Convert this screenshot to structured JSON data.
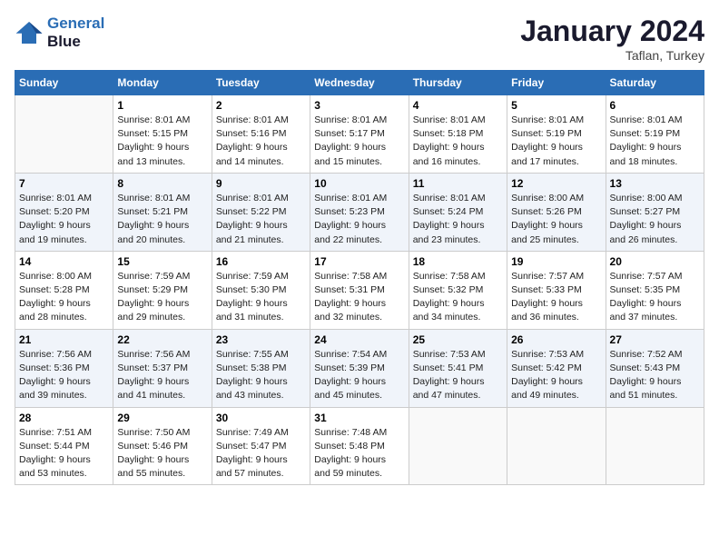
{
  "header": {
    "logo_line1": "General",
    "logo_line2": "Blue",
    "month": "January 2024",
    "location": "Taflan, Turkey"
  },
  "days_of_week": [
    "Sunday",
    "Monday",
    "Tuesday",
    "Wednesday",
    "Thursday",
    "Friday",
    "Saturday"
  ],
  "weeks": [
    [
      {
        "day": "",
        "info": ""
      },
      {
        "day": "1",
        "info": "Sunrise: 8:01 AM\nSunset: 5:15 PM\nDaylight: 9 hours\nand 13 minutes."
      },
      {
        "day": "2",
        "info": "Sunrise: 8:01 AM\nSunset: 5:16 PM\nDaylight: 9 hours\nand 14 minutes."
      },
      {
        "day": "3",
        "info": "Sunrise: 8:01 AM\nSunset: 5:17 PM\nDaylight: 9 hours\nand 15 minutes."
      },
      {
        "day": "4",
        "info": "Sunrise: 8:01 AM\nSunset: 5:18 PM\nDaylight: 9 hours\nand 16 minutes."
      },
      {
        "day": "5",
        "info": "Sunrise: 8:01 AM\nSunset: 5:19 PM\nDaylight: 9 hours\nand 17 minutes."
      },
      {
        "day": "6",
        "info": "Sunrise: 8:01 AM\nSunset: 5:19 PM\nDaylight: 9 hours\nand 18 minutes."
      }
    ],
    [
      {
        "day": "7",
        "info": "Sunrise: 8:01 AM\nSunset: 5:20 PM\nDaylight: 9 hours\nand 19 minutes."
      },
      {
        "day": "8",
        "info": "Sunrise: 8:01 AM\nSunset: 5:21 PM\nDaylight: 9 hours\nand 20 minutes."
      },
      {
        "day": "9",
        "info": "Sunrise: 8:01 AM\nSunset: 5:22 PM\nDaylight: 9 hours\nand 21 minutes."
      },
      {
        "day": "10",
        "info": "Sunrise: 8:01 AM\nSunset: 5:23 PM\nDaylight: 9 hours\nand 22 minutes."
      },
      {
        "day": "11",
        "info": "Sunrise: 8:01 AM\nSunset: 5:24 PM\nDaylight: 9 hours\nand 23 minutes."
      },
      {
        "day": "12",
        "info": "Sunrise: 8:00 AM\nSunset: 5:26 PM\nDaylight: 9 hours\nand 25 minutes."
      },
      {
        "day": "13",
        "info": "Sunrise: 8:00 AM\nSunset: 5:27 PM\nDaylight: 9 hours\nand 26 minutes."
      }
    ],
    [
      {
        "day": "14",
        "info": "Sunrise: 8:00 AM\nSunset: 5:28 PM\nDaylight: 9 hours\nand 28 minutes."
      },
      {
        "day": "15",
        "info": "Sunrise: 7:59 AM\nSunset: 5:29 PM\nDaylight: 9 hours\nand 29 minutes."
      },
      {
        "day": "16",
        "info": "Sunrise: 7:59 AM\nSunset: 5:30 PM\nDaylight: 9 hours\nand 31 minutes."
      },
      {
        "day": "17",
        "info": "Sunrise: 7:58 AM\nSunset: 5:31 PM\nDaylight: 9 hours\nand 32 minutes."
      },
      {
        "day": "18",
        "info": "Sunrise: 7:58 AM\nSunset: 5:32 PM\nDaylight: 9 hours\nand 34 minutes."
      },
      {
        "day": "19",
        "info": "Sunrise: 7:57 AM\nSunset: 5:33 PM\nDaylight: 9 hours\nand 36 minutes."
      },
      {
        "day": "20",
        "info": "Sunrise: 7:57 AM\nSunset: 5:35 PM\nDaylight: 9 hours\nand 37 minutes."
      }
    ],
    [
      {
        "day": "21",
        "info": "Sunrise: 7:56 AM\nSunset: 5:36 PM\nDaylight: 9 hours\nand 39 minutes."
      },
      {
        "day": "22",
        "info": "Sunrise: 7:56 AM\nSunset: 5:37 PM\nDaylight: 9 hours\nand 41 minutes."
      },
      {
        "day": "23",
        "info": "Sunrise: 7:55 AM\nSunset: 5:38 PM\nDaylight: 9 hours\nand 43 minutes."
      },
      {
        "day": "24",
        "info": "Sunrise: 7:54 AM\nSunset: 5:39 PM\nDaylight: 9 hours\nand 45 minutes."
      },
      {
        "day": "25",
        "info": "Sunrise: 7:53 AM\nSunset: 5:41 PM\nDaylight: 9 hours\nand 47 minutes."
      },
      {
        "day": "26",
        "info": "Sunrise: 7:53 AM\nSunset: 5:42 PM\nDaylight: 9 hours\nand 49 minutes."
      },
      {
        "day": "27",
        "info": "Sunrise: 7:52 AM\nSunset: 5:43 PM\nDaylight: 9 hours\nand 51 minutes."
      }
    ],
    [
      {
        "day": "28",
        "info": "Sunrise: 7:51 AM\nSunset: 5:44 PM\nDaylight: 9 hours\nand 53 minutes."
      },
      {
        "day": "29",
        "info": "Sunrise: 7:50 AM\nSunset: 5:46 PM\nDaylight: 9 hours\nand 55 minutes."
      },
      {
        "day": "30",
        "info": "Sunrise: 7:49 AM\nSunset: 5:47 PM\nDaylight: 9 hours\nand 57 minutes."
      },
      {
        "day": "31",
        "info": "Sunrise: 7:48 AM\nSunset: 5:48 PM\nDaylight: 9 hours\nand 59 minutes."
      },
      {
        "day": "",
        "info": ""
      },
      {
        "day": "",
        "info": ""
      },
      {
        "day": "",
        "info": ""
      }
    ]
  ]
}
